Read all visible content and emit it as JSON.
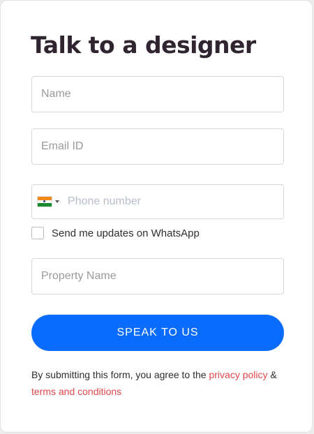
{
  "form": {
    "title": "Talk to a designer",
    "name_placeholder": "Name",
    "email_placeholder": "Email ID",
    "phone": {
      "country_flag": "india-flag-icon",
      "placeholder": "Phone number"
    },
    "whatsapp_label": "Send me updates on WhatsApp",
    "whatsapp_checked": false,
    "property_placeholder": "Property Name",
    "submit_label": "SPEAK TO US",
    "consent": {
      "prefix": "By submitting this form, you agree to the ",
      "privacy_link": "privacy policy",
      "joiner": " & ",
      "terms_link": "terms and conditions"
    }
  },
  "colors": {
    "title": "#2f2430",
    "button": "#0a6cff",
    "link": "#e0474c"
  }
}
